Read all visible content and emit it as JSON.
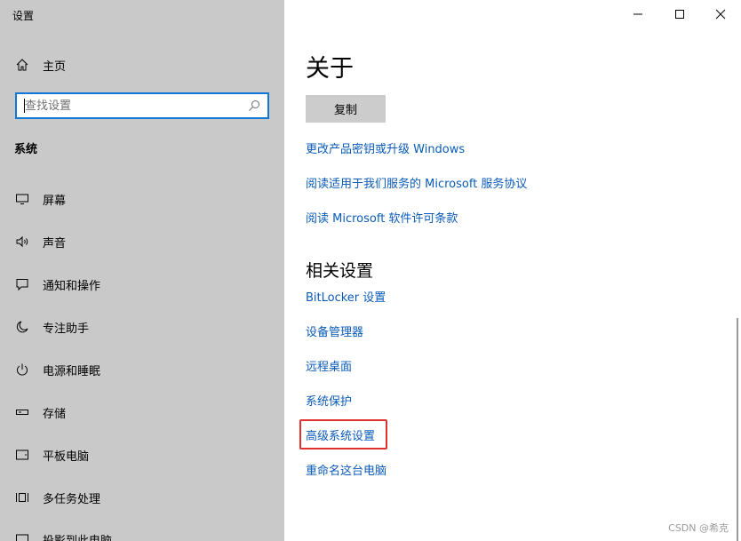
{
  "app": {
    "title": "设置"
  },
  "sidebar": {
    "home_label": "主页",
    "search_placeholder": "查找设置",
    "section_label": "系统",
    "items": [
      {
        "label": "屏幕",
        "icon": "monitor-icon"
      },
      {
        "label": "声音",
        "icon": "speaker-icon"
      },
      {
        "label": "通知和操作",
        "icon": "notification-icon"
      },
      {
        "label": "专注助手",
        "icon": "moon-icon"
      },
      {
        "label": "电源和睡眠",
        "icon": "power-icon"
      },
      {
        "label": "存储",
        "icon": "storage-icon"
      },
      {
        "label": "平板电脑",
        "icon": "tablet-icon"
      },
      {
        "label": "多任务处理",
        "icon": "multitask-icon"
      },
      {
        "label": "投影到此电脑",
        "icon": "projection-icon"
      }
    ]
  },
  "window_controls": {
    "minimize": "minimize-icon",
    "maximize": "maximize-icon",
    "close": "close-icon"
  },
  "main": {
    "title": "关于",
    "copy_button": "复制",
    "links": [
      "更改产品密钥或升级 Windows",
      "阅读适用于我们服务的 Microsoft 服务协议",
      "阅读 Microsoft 软件许可条款"
    ],
    "related_title": "相关设置",
    "related_links": [
      "BitLocker 设置",
      "设备管理器",
      "远程桌面",
      "系统保护",
      "高级系统设置",
      "重命名这台电脑"
    ],
    "highlighted": "高级系统设置"
  },
  "watermark": "CSDN @希克",
  "colors": {
    "sidebar_bg": "#c9c9c9",
    "accent": "#0f78d6",
    "link": "#0a5bb8",
    "highlight": "#e03030"
  }
}
